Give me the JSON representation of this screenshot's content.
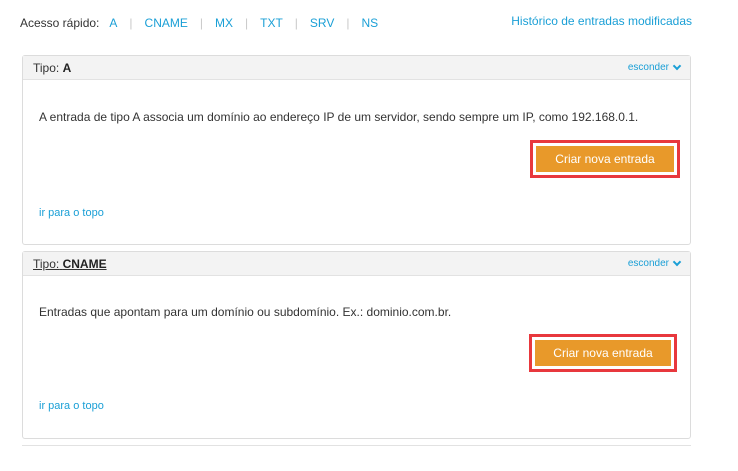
{
  "quick_access": {
    "label": "Acesso rápido:",
    "links": [
      "A",
      "CNAME",
      "MX",
      "TXT",
      "SRV",
      "NS"
    ],
    "separator": "|",
    "history_link": "Histórico de entradas modificadas"
  },
  "panels": [
    {
      "type_label": "Tipo:",
      "type_value": "A",
      "toggle_label": "esconder",
      "description": "A entrada de tipo A associa um domínio ao endereço IP de um servidor, sendo sempre um IP, como 192.168.0.1.",
      "button_label": "Criar nova entrada",
      "top_link": "ir para o topo"
    },
    {
      "type_label": "Tipo:",
      "type_value": "CNAME",
      "toggle_label": "esconder",
      "description": "Entradas que apontam para um domínio ou subdomínio. Ex.: dominio.com.br.",
      "button_label": "Criar nova entrada",
      "top_link": "ir para o topo"
    }
  ],
  "colors": {
    "link": "#1a9fd6",
    "button": "#e8992a",
    "highlight_border": "#e8383d",
    "panel_header": "#f3f3f3"
  }
}
